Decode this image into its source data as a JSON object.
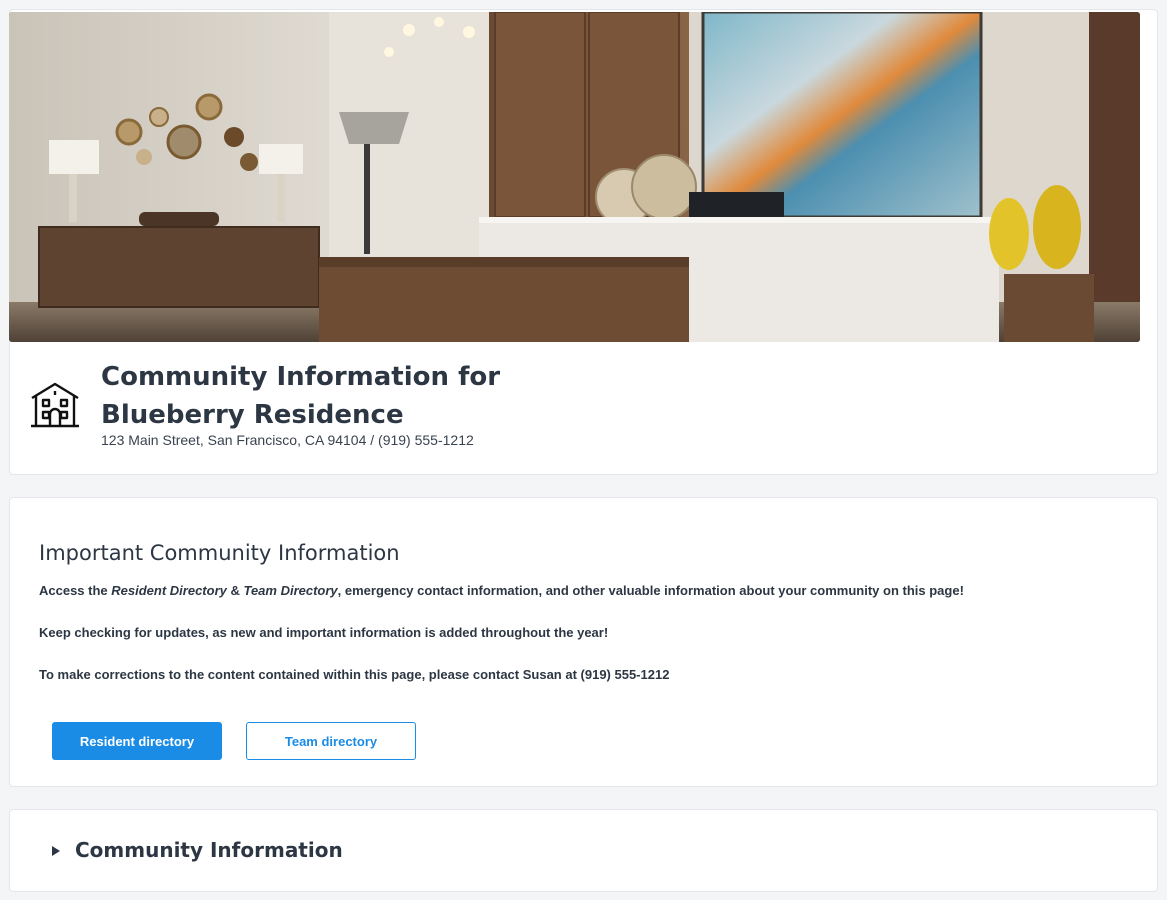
{
  "header": {
    "icon": "apartment-building-icon",
    "title": "Community Information for Blueberry Residence",
    "title_line1": "Community Information for",
    "title_line2": "Blueberry Residence",
    "address": "123 Main Street, San Francisco, CA 94104 / (919) 555-1212"
  },
  "info": {
    "heading": "Important Community Information",
    "para1_prefix": "Access the ",
    "para1_resident": "Resident Directory",
    "para1_amp": " & ",
    "para1_team": "Team Directory",
    "para1_suffix": ", emergency contact information, and other valuable information about your community on this page!",
    "para2": "Keep checking for updates, as new and important information is added throughout the year!",
    "para3": "To make corrections to the content contained within this page, please contact Susan at (919) 555-1212",
    "buttons": {
      "resident_label": "Resident directory",
      "team_label": "Team directory"
    }
  },
  "collapsible": {
    "icon": "caret-right-icon",
    "title": "Community Information"
  },
  "colors": {
    "accent": "#1a8ce6",
    "text": "#2d3744",
    "page_bg": "#f4f5f7"
  }
}
